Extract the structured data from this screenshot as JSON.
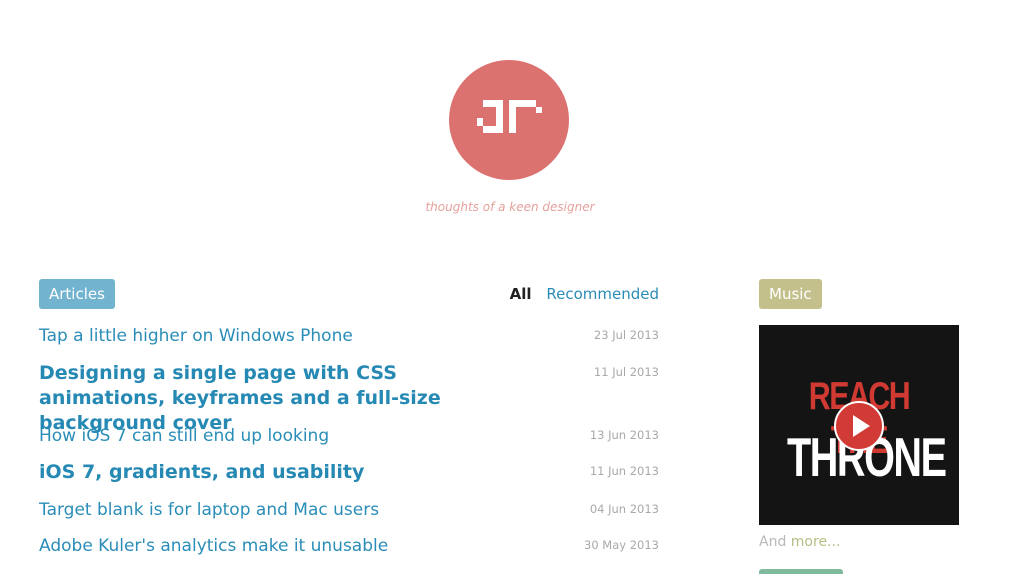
{
  "site": {
    "tagline": "thoughts of a keen designer",
    "logo_color": "#dc726f"
  },
  "articles_section": {
    "badge": "Articles",
    "filters": {
      "all": "All",
      "recommended": "Recommended"
    },
    "items": [
      {
        "title": "Tap a little higher on Windows Phone",
        "date": "23 Jul 2013",
        "featured": false
      },
      {
        "title": "Designing a single page with CSS animations, keyframes and a full-size background cover",
        "date": "11 Jul 2013",
        "featured": true
      },
      {
        "title": "How iOS 7 can still end up looking",
        "date": "13 Jun 2013",
        "featured": false
      },
      {
        "title": "iOS 7, gradients, and usability",
        "date": "11 Jun 2013",
        "featured": true
      },
      {
        "title": "Target blank is for laptop and Mac users",
        "date": "04 Jun 2013",
        "featured": false
      },
      {
        "title": "Adobe Kuler's analytics make it unusable",
        "date": "30 May 2013",
        "featured": false
      }
    ]
  },
  "music_section": {
    "badge": "Music",
    "album": {
      "line1": "REACH THE",
      "line2": "THRONE"
    },
    "more_prefix": "And ",
    "more_link": "more..."
  },
  "colors": {
    "articles_badge": "#72b3d0",
    "music_badge": "#c3c08c",
    "link": "#2a8db7",
    "date": "#a9a9a9"
  }
}
